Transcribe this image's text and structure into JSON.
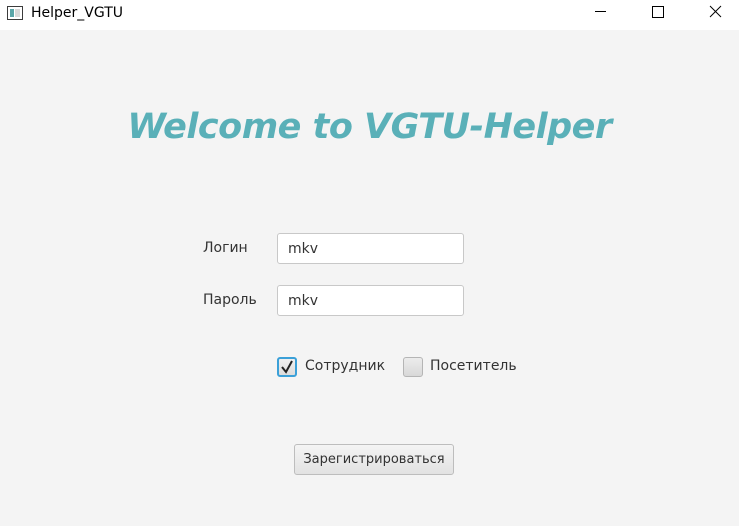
{
  "window": {
    "title": "Helper_VGTU"
  },
  "welcome": {
    "heading": "Welcome to VGTU-Helper"
  },
  "form": {
    "login_label": "Логин",
    "login_value": "mkv",
    "password_label": "Пароль",
    "password_value": "mkv"
  },
  "roles": {
    "staff_label": "Сотрудник",
    "staff_checked": true,
    "visitor_label": "Посетитель",
    "visitor_checked": false
  },
  "actions": {
    "register_label": "Зарегистрироваться"
  },
  "colors": {
    "accent": "#5ab0b8",
    "focus": "#3ba0d8",
    "background": "#f4f4f4"
  }
}
